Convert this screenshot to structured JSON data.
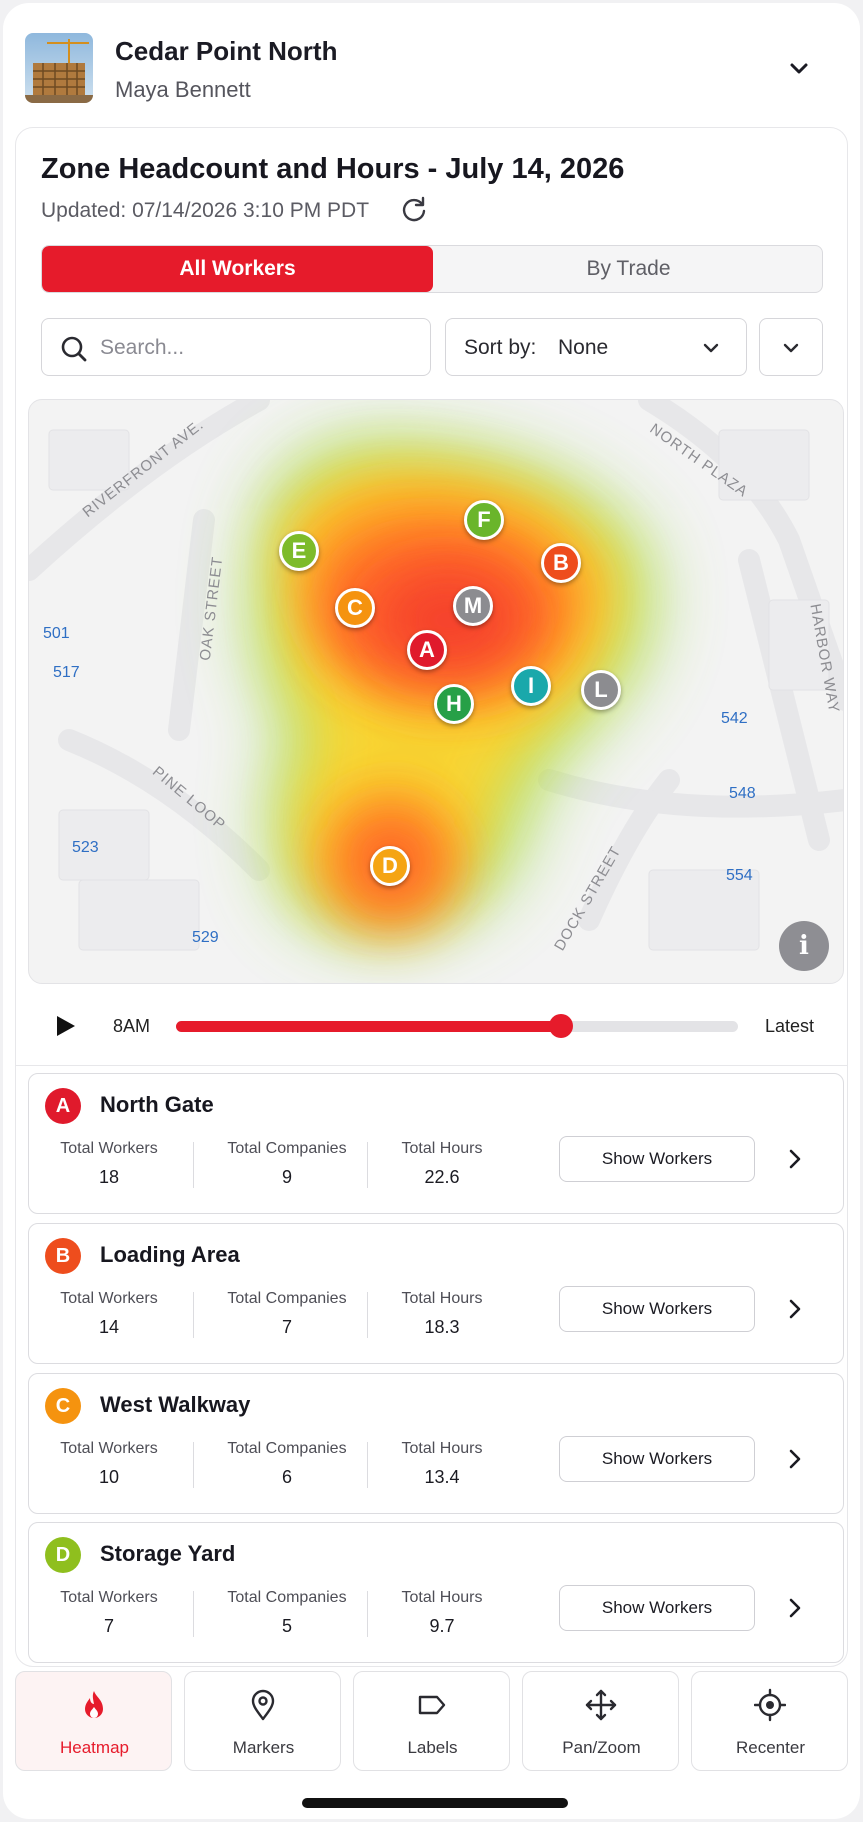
{
  "header": {
    "site_name": "Cedar Point North",
    "user_name": "Maya Bennett"
  },
  "report": {
    "title": "Zone Headcount and Hours - July 14, 2026",
    "updated": "Updated: 07/14/2026 3:10 PM PDT"
  },
  "segment": {
    "options": [
      "All Workers",
      "By Trade"
    ],
    "selected": "All Workers"
  },
  "search": {
    "placeholder": "Search...",
    "value": ""
  },
  "sort": {
    "label": "Sort by:",
    "value": "None"
  },
  "map": {
    "streets": [
      "RIVERFRONT AVE.",
      "NORTH PLAZA",
      "OAK STREET",
      "HARBOR WAY",
      "PINE LOOP",
      "DOCK STREET"
    ],
    "lots": [
      "501",
      "517",
      "523",
      "529",
      "542",
      "548",
      "554"
    ],
    "pins": [
      {
        "letter": "E",
        "color": "#7dbb2a"
      },
      {
        "letter": "F",
        "color": "#6ab52b"
      },
      {
        "letter": "B",
        "color": "#ee4d1d"
      },
      {
        "letter": "C",
        "color": "#f5930f"
      },
      {
        "letter": "M",
        "color": "#8c8c90"
      },
      {
        "letter": "A",
        "color": "#e01a2c"
      },
      {
        "letter": "I",
        "color": "#1aa8ab"
      },
      {
        "letter": "L",
        "color": "#8c8c90"
      },
      {
        "letter": "H",
        "color": "#27a047"
      },
      {
        "letter": "D",
        "color": "#f5a413"
      }
    ],
    "info_icon": "i"
  },
  "timeline": {
    "start": "8AM",
    "end": "Latest",
    "progress": 0.685
  },
  "zones": [
    {
      "letter": "A",
      "color": "#e01a2c",
      "name": "North Gate",
      "workers": "18",
      "companies": "9",
      "hours": "22.6"
    },
    {
      "letter": "B",
      "color": "#ee4d1d",
      "name": "Loading Area",
      "workers": "14",
      "companies": "7",
      "hours": "18.3"
    },
    {
      "letter": "C",
      "color": "#f5930f",
      "name": "West Walkway",
      "workers": "10",
      "companies": "6",
      "hours": "13.4"
    },
    {
      "letter": "D",
      "color": "#8fbf1e",
      "name": "Storage Yard",
      "workers": "7",
      "companies": "5",
      "hours": "9.7"
    }
  ],
  "stat_labels": {
    "workers": "Total Workers",
    "companies": "Total Companies",
    "hours": "Total Hours"
  },
  "show_workers_label": "Show Workers",
  "tabs": [
    {
      "label": "Heatmap",
      "icon": "flame-icon"
    },
    {
      "label": "Markers",
      "icon": "map-pin-icon"
    },
    {
      "label": "Labels",
      "icon": "tag-icon"
    },
    {
      "label": "Pan/Zoom",
      "icon": "move-arrows-icon"
    },
    {
      "label": "Recenter",
      "icon": "crosshair-icon"
    }
  ],
  "active_tab": "Heatmap",
  "colors": {
    "accent": "#e61b2b",
    "link": "#2f6fc4"
  }
}
